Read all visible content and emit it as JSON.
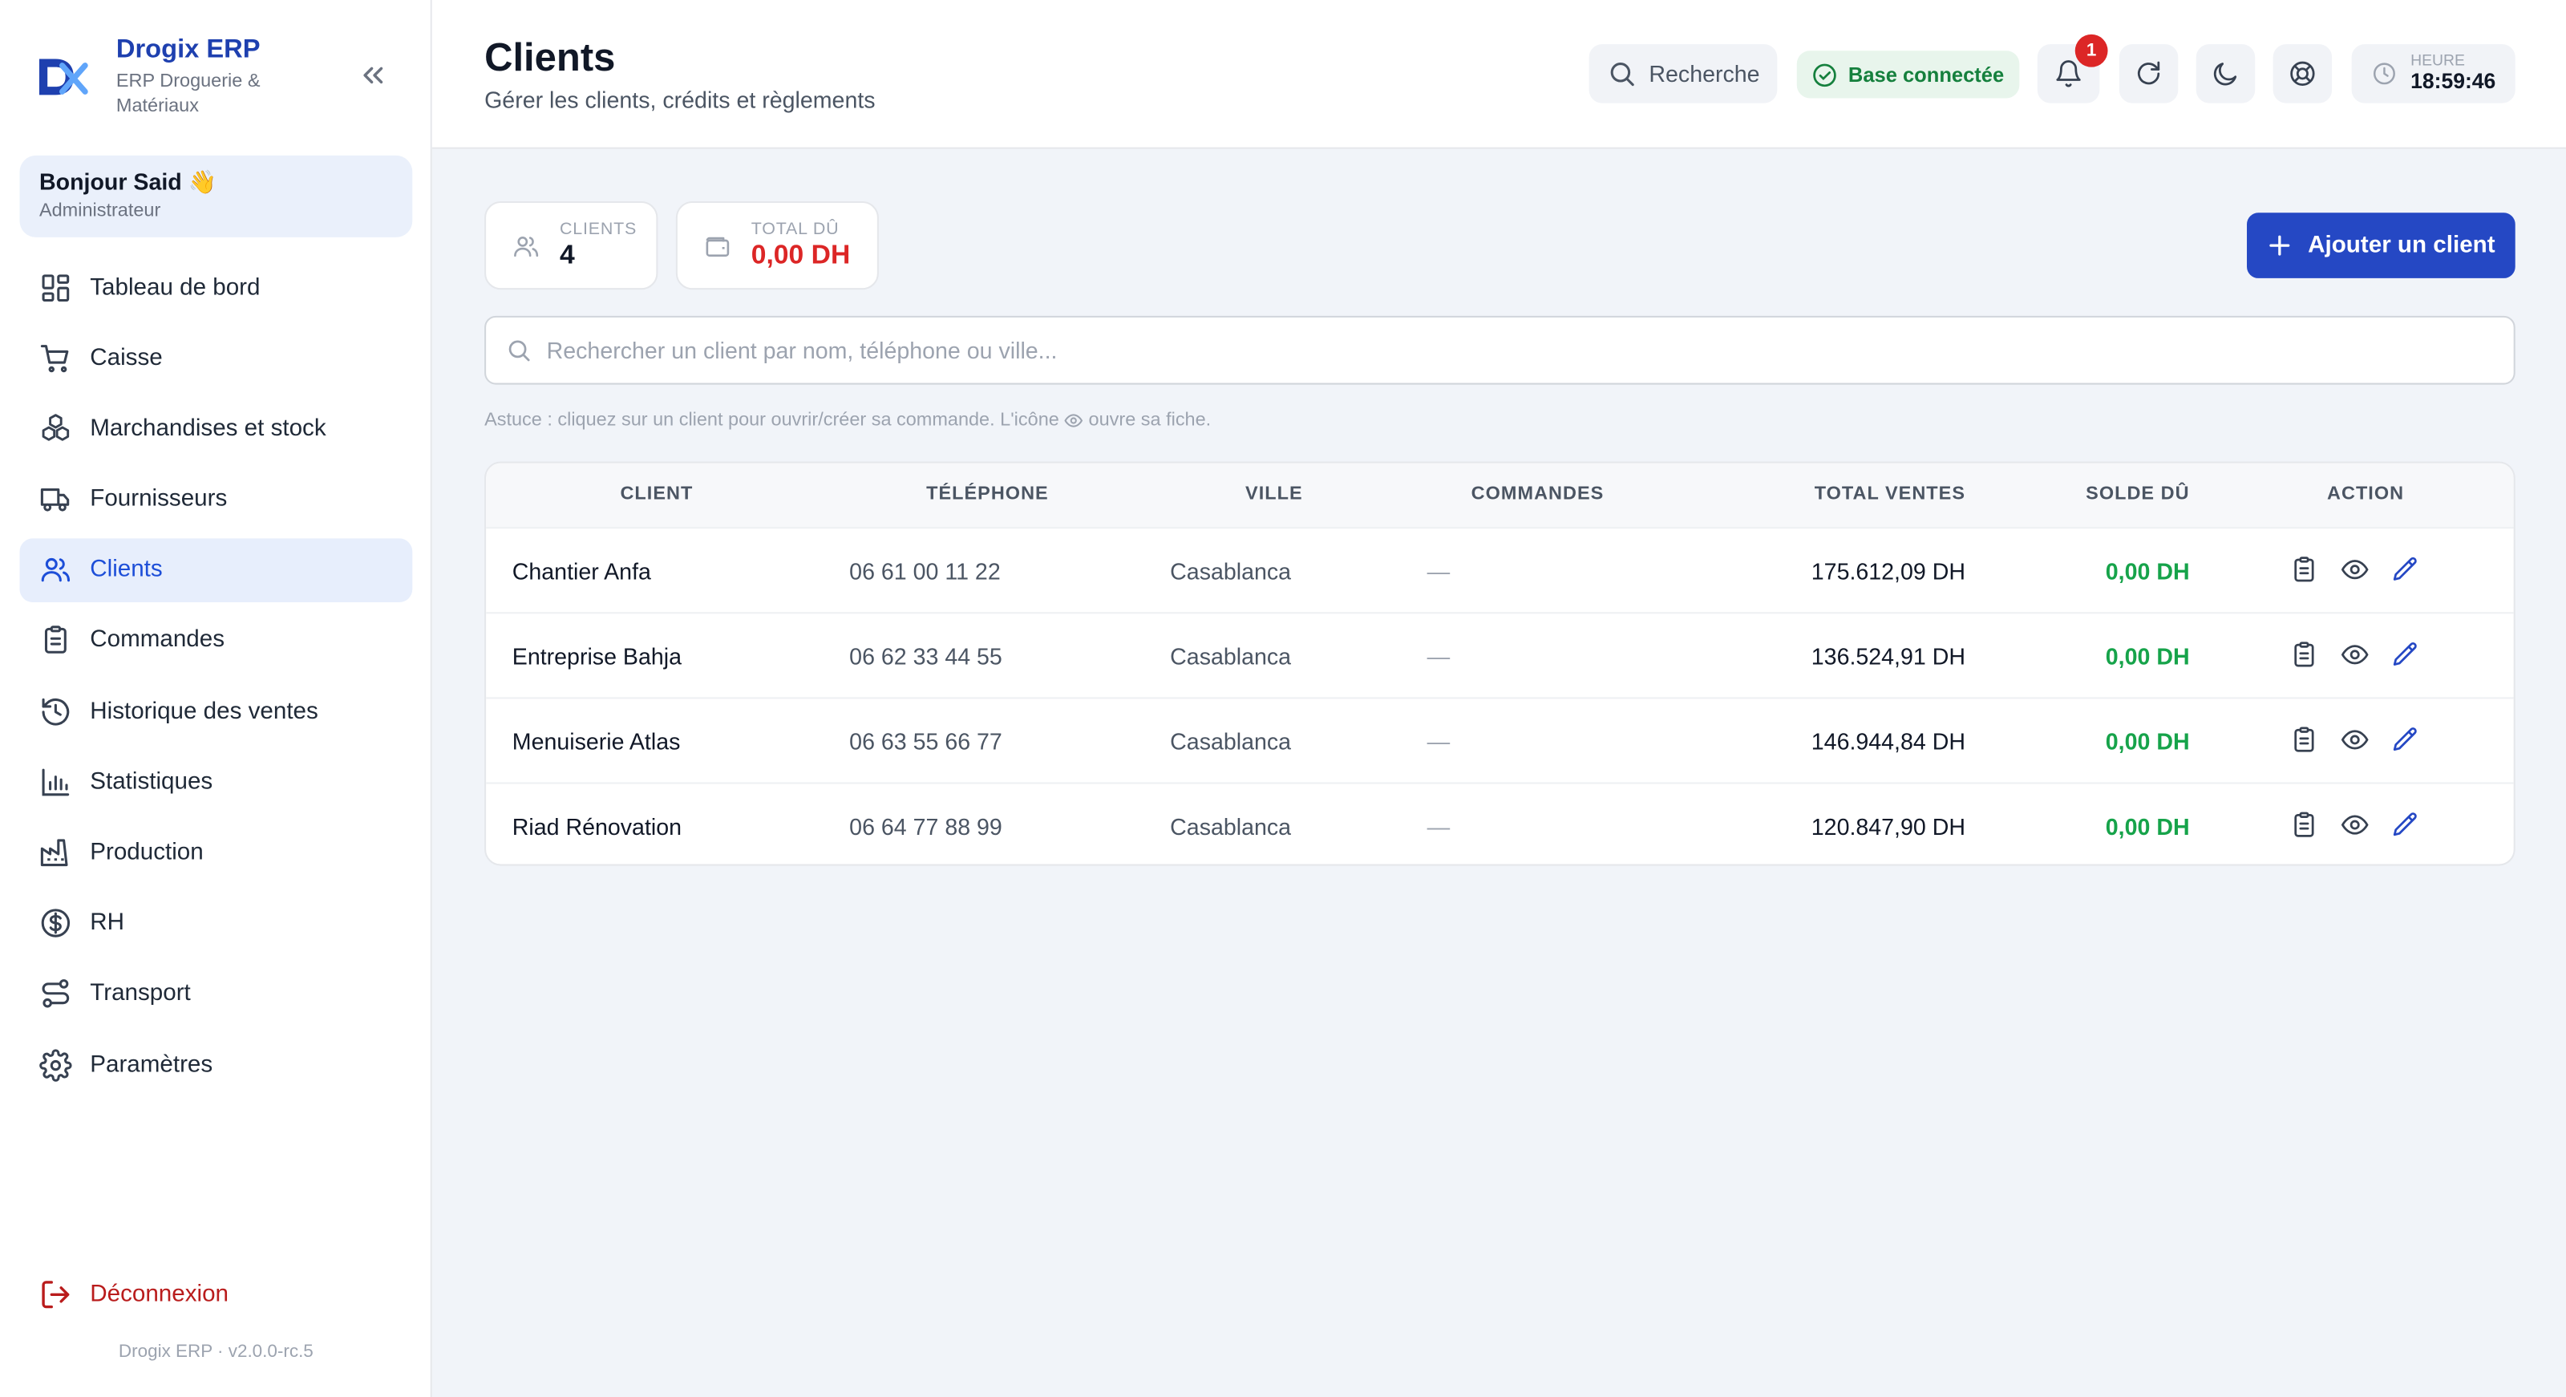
{
  "sidebar": {
    "brand_name": "Drogix ERP",
    "brand_sub": "ERP Droguerie & Matériaux",
    "greeting": "Bonjour Said 👋",
    "role": "Administrateur",
    "items": [
      {
        "label": "Tableau de bord",
        "icon": "dashboard-icon"
      },
      {
        "label": "Caisse",
        "icon": "cart-icon"
      },
      {
        "label": "Marchandises et stock",
        "icon": "boxes-icon"
      },
      {
        "label": "Fournisseurs",
        "icon": "truck-icon"
      },
      {
        "label": "Clients",
        "icon": "users-icon",
        "active": true
      },
      {
        "label": "Commandes",
        "icon": "clipboard-icon"
      },
      {
        "label": "Historique des ventes",
        "icon": "history-icon"
      },
      {
        "label": "Statistiques",
        "icon": "bar-chart-icon"
      },
      {
        "label": "Production",
        "icon": "factory-icon"
      },
      {
        "label": "RH",
        "icon": "dollar-circle-icon"
      },
      {
        "label": "Transport",
        "icon": "route-icon"
      },
      {
        "label": "Paramètres",
        "icon": "gear-icon"
      }
    ],
    "logout": "Déconnexion",
    "version": "Drogix ERP · v2.0.0-rc.5"
  },
  "header": {
    "title": "Clients",
    "subtitle": "Gérer les clients, crédits et règlements",
    "search_label": "Recherche",
    "db_status": "Base connectée",
    "notifications": "1",
    "clock_label": "HEURE",
    "clock_time": "18:59:46"
  },
  "stats": {
    "clients_label": "CLIENTS",
    "clients_value": "4",
    "total_label": "TOTAL DÛ",
    "total_value": "0,00 DH"
  },
  "add_button": "Ajouter un client",
  "search": {
    "placeholder": "Rechercher un client par nom, téléphone ou ville..."
  },
  "tip": {
    "before": "Astuce : cliquez sur un client pour ouvrir/créer sa commande. L'icône",
    "after": "ouvre sa fiche."
  },
  "table": {
    "headers": [
      "CLIENT",
      "TÉLÉPHONE",
      "VILLE",
      "COMMANDES",
      "TOTAL VENTES",
      "SOLDE DÛ",
      "ACTION"
    ],
    "rows": [
      {
        "client": "Chantier Anfa",
        "phone": "06 61 00 11 22",
        "city": "Casablanca",
        "orders": "—",
        "total": "175.612,09 DH",
        "due": "0,00 DH"
      },
      {
        "client": "Entreprise Bahja",
        "phone": "06 62 33 44 55",
        "city": "Casablanca",
        "orders": "—",
        "total": "136.524,91 DH",
        "due": "0,00 DH"
      },
      {
        "client": "Menuiserie Atlas",
        "phone": "06 63 55 66 77",
        "city": "Casablanca",
        "orders": "—",
        "total": "146.944,84 DH",
        "due": "0,00 DH"
      },
      {
        "client": "Riad Rénovation",
        "phone": "06 64 77 88 99",
        "city": "Casablanca",
        "orders": "—",
        "total": "120.847,90 DH",
        "due": "0,00 DH"
      }
    ]
  },
  "colors": {
    "accent": "#2548c4",
    "danger": "#dc2626",
    "success": "#16a34a",
    "active_bg": "#e7eefc"
  }
}
